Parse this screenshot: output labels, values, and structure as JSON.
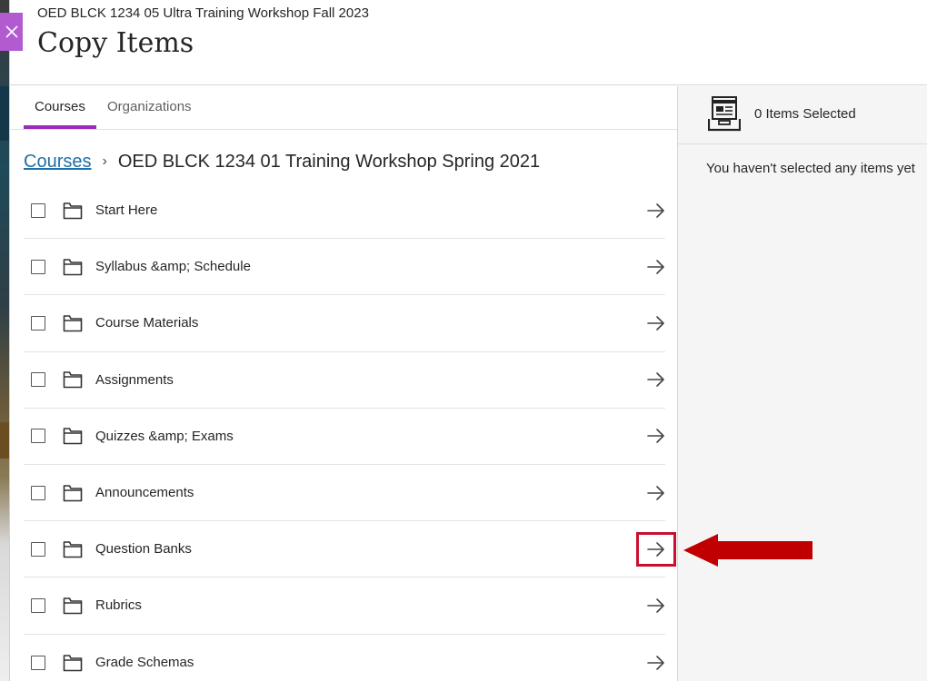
{
  "header": {
    "subtitle": "OED BLCK 1234 05 Ultra Training Workshop Fall 2023",
    "title": "Copy Items"
  },
  "tabs": [
    {
      "label": "Courses",
      "active": true
    },
    {
      "label": "Organizations",
      "active": false
    }
  ],
  "breadcrumb": {
    "root": "Courses",
    "current": "OED BLCK 1234 01 Training Workshop Spring 2021"
  },
  "items": [
    {
      "label": "Start Here"
    },
    {
      "label": "Syllabus &amp; Schedule"
    },
    {
      "label": "Course Materials"
    },
    {
      "label": "Assignments"
    },
    {
      "label": "Quizzes &amp; Exams"
    },
    {
      "label": "Announcements"
    },
    {
      "label": "Question Banks",
      "highlighted": true
    },
    {
      "label": "Rubrics"
    },
    {
      "label": "Grade Schemas"
    }
  ],
  "selection": {
    "count_label": "0 Items Selected",
    "empty_message": "You haven't selected any items yet"
  },
  "icons": {
    "close": "close-icon",
    "folder": "folder-icon",
    "arrow": "arrow-right-icon",
    "basket": "copy-basket-icon"
  },
  "colors": {
    "accent": "#9b2ab8",
    "close_bg": "#b25bd1",
    "link": "#1f6fa8",
    "highlight": "#c8102e"
  }
}
